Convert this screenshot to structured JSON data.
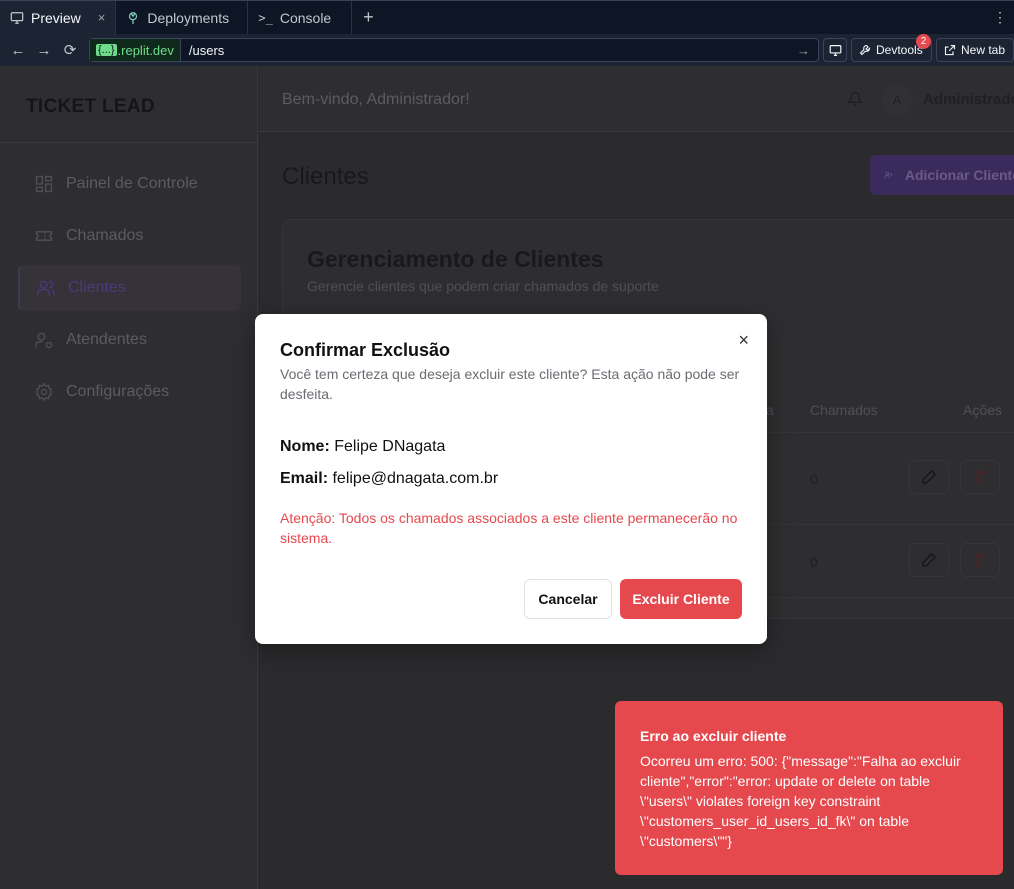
{
  "browser": {
    "tabs": [
      {
        "label": "Preview",
        "close": "×"
      },
      {
        "label": "Deployments"
      },
      {
        "label": "Console"
      }
    ],
    "new_tab_symbol": "+",
    "menu_symbol": "⋮",
    "url_domain_brace": "{...}",
    "url_domain": ".replit.dev",
    "url_path": "/users",
    "devtools_label": "Devtools",
    "devtools_badge": "2",
    "newtab_label": "New tab"
  },
  "app": {
    "brand": "TICKET LEAD",
    "sidebar": {
      "items": [
        {
          "label": "Painel de Controle",
          "icon": "dashboard-icon"
        },
        {
          "label": "Chamados",
          "icon": "ticket-icon"
        },
        {
          "label": "Clientes",
          "icon": "users-icon",
          "active": true
        },
        {
          "label": "Atendentes",
          "icon": "user-gear-icon"
        },
        {
          "label": "Configurações",
          "icon": "gear-icon"
        }
      ]
    },
    "header": {
      "welcome": "Bem-vindo, Administrador!",
      "avatar_initial": "A",
      "user_name": "Administrador"
    },
    "page": {
      "title": "Clientes",
      "add_button": "Adicionar Cliente",
      "card_title": "Gerenciamento de Clientes",
      "card_subtitle": "Gerencie clientes que podem criar chamados de suporte",
      "columns": {
        "partial_company": "sa",
        "tickets": "Chamados",
        "actions": "Ações"
      },
      "rows": [
        {
          "tickets": "0"
        },
        {
          "tickets": "0"
        }
      ]
    }
  },
  "modal": {
    "title": "Confirmar Exclusão",
    "description": "Você tem certeza que deseja excluir este cliente? Esta ação não pode ser desfeita.",
    "name_label": "Nome:",
    "name_value": "Felipe DNagata",
    "email_label": "Email:",
    "email_value": "felipe@dnagata.com.br",
    "warning": "Atenção: Todos os chamados associados a este cliente permanecerão no sistema.",
    "cancel_label": "Cancelar",
    "confirm_label": "Excluir Cliente",
    "close_symbol": "×"
  },
  "toast": {
    "title": "Erro ao excluir cliente",
    "message": "Ocorreu um erro: 500: {\"message\":\"Falha ao excluir cliente\",\"error\":\"error: update or delete on table \\\"users\\\" violates foreign key constraint \\\"customers_user_id_users_id_fk\\\" on table \\\"customers\\\"\"}"
  },
  "colors": {
    "accent": "#7c3aed",
    "danger": "#e5484d"
  }
}
